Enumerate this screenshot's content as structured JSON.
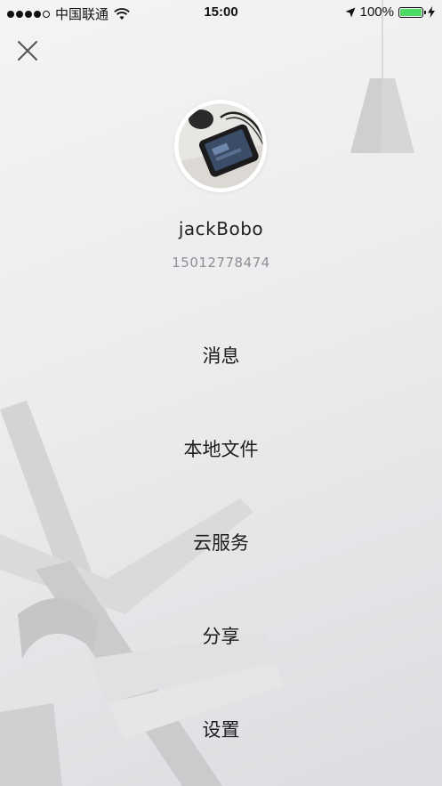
{
  "status_bar": {
    "carrier": "中国联通",
    "time": "15:00",
    "battery_percent": "100%",
    "battery_level": 1.0,
    "battery_color": "#4cd964"
  },
  "close_icon": "close-icon",
  "profile": {
    "username": "jackBobo",
    "phone": "15012778474"
  },
  "menu": {
    "items": [
      {
        "label": "消息"
      },
      {
        "label": "本地文件"
      },
      {
        "label": "云服务"
      },
      {
        "label": "分享"
      },
      {
        "label": "设置"
      }
    ]
  }
}
